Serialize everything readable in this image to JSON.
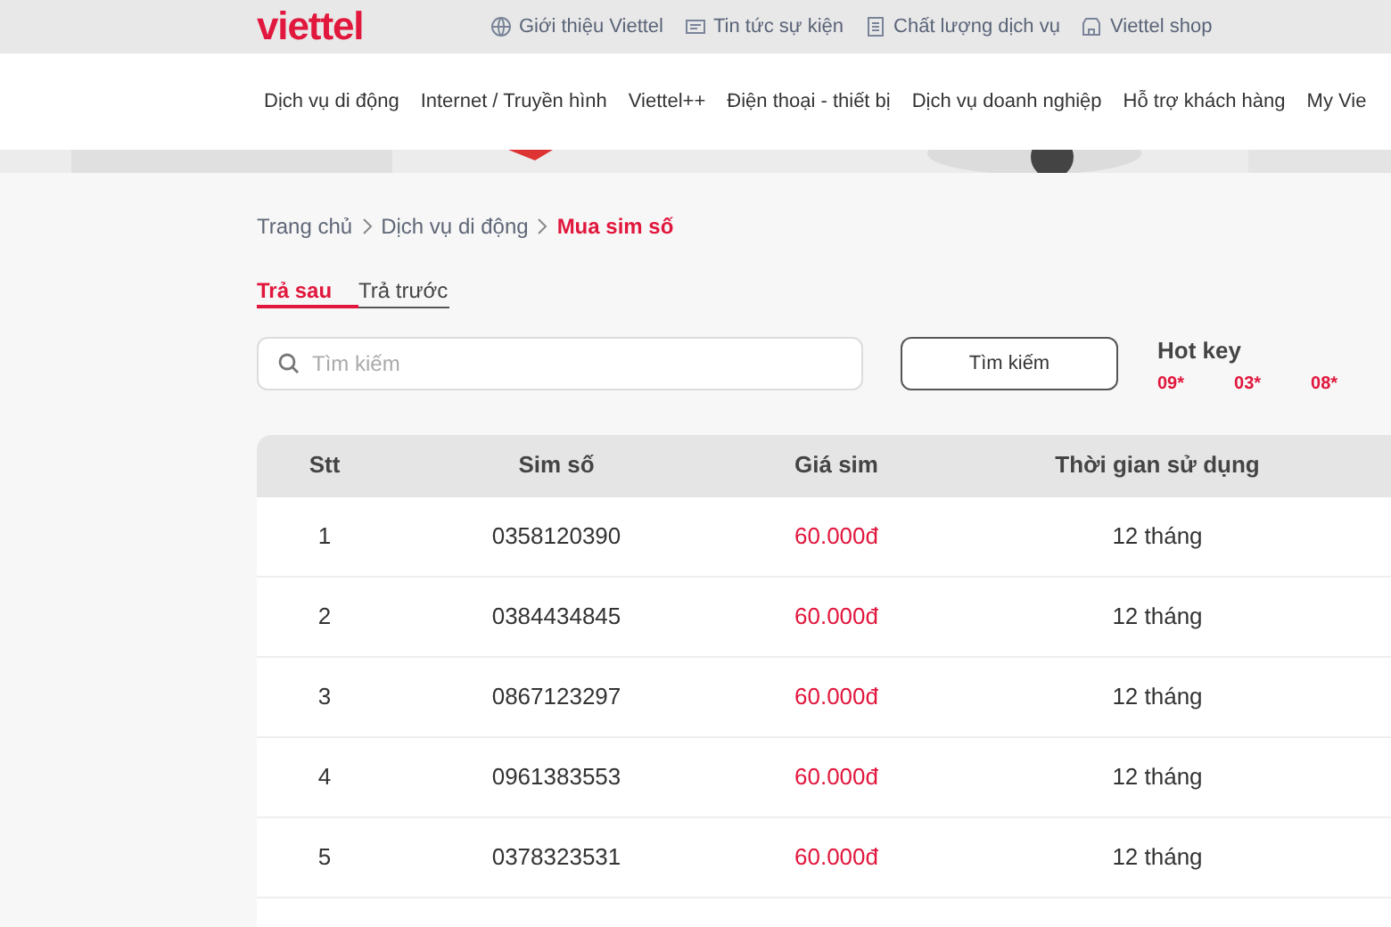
{
  "header": {
    "logo": "viettel",
    "links": [
      {
        "label": "Giới thiệu Viettel"
      },
      {
        "label": "Tin tức sự kiện"
      },
      {
        "label": "Chất lượng dịch vụ"
      },
      {
        "label": "Viettel shop"
      }
    ]
  },
  "nav": {
    "items": [
      "Dịch vụ di động",
      "Internet / Truyền hình",
      "Viettel++",
      "Điện thoại - thiết bị",
      "Dịch vụ doanh nghiệp",
      "Hỗ trợ khách hàng",
      "My Vie"
    ]
  },
  "breadcrumb": [
    {
      "label": "Trang chủ",
      "selected": false
    },
    {
      "label": "Dịch vụ di động",
      "selected": false
    },
    {
      "label": "Mua sim số",
      "selected": true
    }
  ],
  "tabs": [
    {
      "label": "Trả sau",
      "selected": true
    },
    {
      "label": "Trả trước",
      "selected": false
    }
  ],
  "search": {
    "placeholder": "Tìm kiếm",
    "button": "Tìm kiếm"
  },
  "hot_key": {
    "title": "Hot key",
    "keys": [
      "09*",
      "03*",
      "08*"
    ]
  },
  "table": {
    "columns": [
      "Stt",
      "Sim số",
      "Giá sim",
      "Thời gian sử dụng"
    ],
    "rows": [
      [
        "1",
        "0358120390",
        "60.000đ",
        "12 tháng"
      ],
      [
        "2",
        "0384434845",
        "60.000đ",
        "12 tháng"
      ],
      [
        "3",
        "0867123297",
        "60.000đ",
        "12 tháng"
      ],
      [
        "4",
        "0961383553",
        "60.000đ",
        "12 tháng"
      ],
      [
        "5",
        "0378323531",
        "60.000đ",
        "12 tháng"
      ]
    ]
  }
}
